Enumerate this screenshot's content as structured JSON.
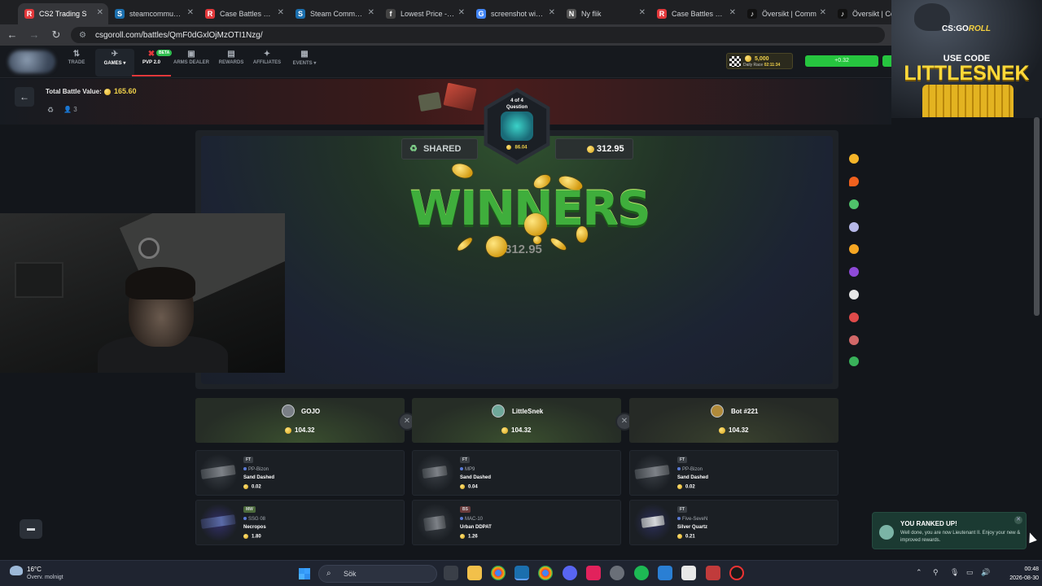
{
  "browser": {
    "tabs": [
      {
        "label": "CS2 Trading S",
        "icon": "R",
        "color": "#e2383b",
        "active": true
      },
      {
        "label": "steamcommunity",
        "icon": "S",
        "color": "#1b6fae",
        "active": false
      },
      {
        "label": "Case Battles at th",
        "icon": "R",
        "color": "#e2383b",
        "active": false
      },
      {
        "label": "Steam Communit",
        "icon": "S",
        "color": "#1b6fae",
        "active": false
      },
      {
        "label": "Lowest Price - CS",
        "icon": "f",
        "color": "#444444",
        "active": false
      },
      {
        "label": "screenshot windo",
        "icon": "G",
        "color": "#4285f4",
        "active": false
      },
      {
        "label": "Ny flik",
        "icon": "N",
        "color": "#555555",
        "active": false
      },
      {
        "label": "Case Battles at th",
        "icon": "R",
        "color": "#e2383b",
        "active": false
      },
      {
        "label": "Översikt | Comm",
        "icon": "♪",
        "color": "#111111",
        "active": false
      },
      {
        "label": "Översikt | Con",
        "icon": "♪",
        "color": "#111111",
        "active": false
      }
    ],
    "url": "csgoroll.com/battles/QmF0dGxlOjMzOTI1Nzg/"
  },
  "nav": {
    "items": [
      {
        "label": "TRADE",
        "icon": "⇅"
      },
      {
        "label": "GAMES ▾",
        "icon": "✈"
      },
      {
        "label": "PVP 2.0",
        "icon": "✖",
        "badge": "BETA"
      },
      {
        "label": "ARMS DEALER",
        "icon": "▣"
      },
      {
        "label": "REWARDS",
        "icon": "▤"
      },
      {
        "label": "AFFILIATES",
        "icon": "✦"
      },
      {
        "label": "EVENTS ▾",
        "icon": "▦"
      }
    ],
    "balance": "5,000",
    "race_label": "Daily Race",
    "race_time": "02:11:34",
    "wallet": "+0.32"
  },
  "promo": {
    "brand": "CS:GO",
    "brand_suffix": "ROLL",
    "use_code": "USE CODE",
    "code": "LITTLESNEK"
  },
  "battle": {
    "total_label": "Total Battle Value:",
    "total_value": "165.60",
    "players_count": "3",
    "round_label_1": "4 of 4",
    "round_label_2": "Question",
    "round_value": "86.04",
    "mode": "SHARED",
    "pot": "312.95",
    "winners_text": "WINNERS",
    "winners_value": "312.95"
  },
  "players": [
    {
      "name": "GOJO",
      "value": "104.32",
      "items": [
        {
          "wear": "FT",
          "weapon": "PP-Bizon",
          "skin": "Sand Dashed",
          "value": "0.02"
        },
        {
          "wear": "MW",
          "weapon": "SSG 08",
          "skin": "Necropos",
          "value": "1.80"
        }
      ]
    },
    {
      "name": "LittleSnek",
      "value": "104.32",
      "items": [
        {
          "wear": "FT",
          "weapon": "MP9",
          "skin": "Sand Dashed",
          "value": "0.04"
        },
        {
          "wear": "BS",
          "weapon": "MAC-10",
          "skin": "Urban DDPAT",
          "value": "1.26"
        }
      ]
    },
    {
      "name": "Bot #221",
      "value": "104.32",
      "items": [
        {
          "wear": "FT",
          "weapon": "PP-Bizon",
          "skin": "Sand Dashed",
          "value": "0.02"
        },
        {
          "wear": "FT",
          "weapon": "Five-SeveN",
          "skin": "Silver Quartz",
          "value": "0.21"
        }
      ]
    }
  ],
  "toast": {
    "title": "YOU RANKED UP!",
    "message": "Well done, you are now Lieutenant II. Enjoy your new & improved rewards."
  },
  "taskbar": {
    "temp": "16°C",
    "weather": "Överv. molnigt",
    "search": "Sök",
    "time": "00:48",
    "date": "2026-08-30"
  },
  "colors": {
    "accent_green": "#26c53f",
    "coin_gold": "#f0d14a",
    "pvp_red": "#e2383b"
  }
}
